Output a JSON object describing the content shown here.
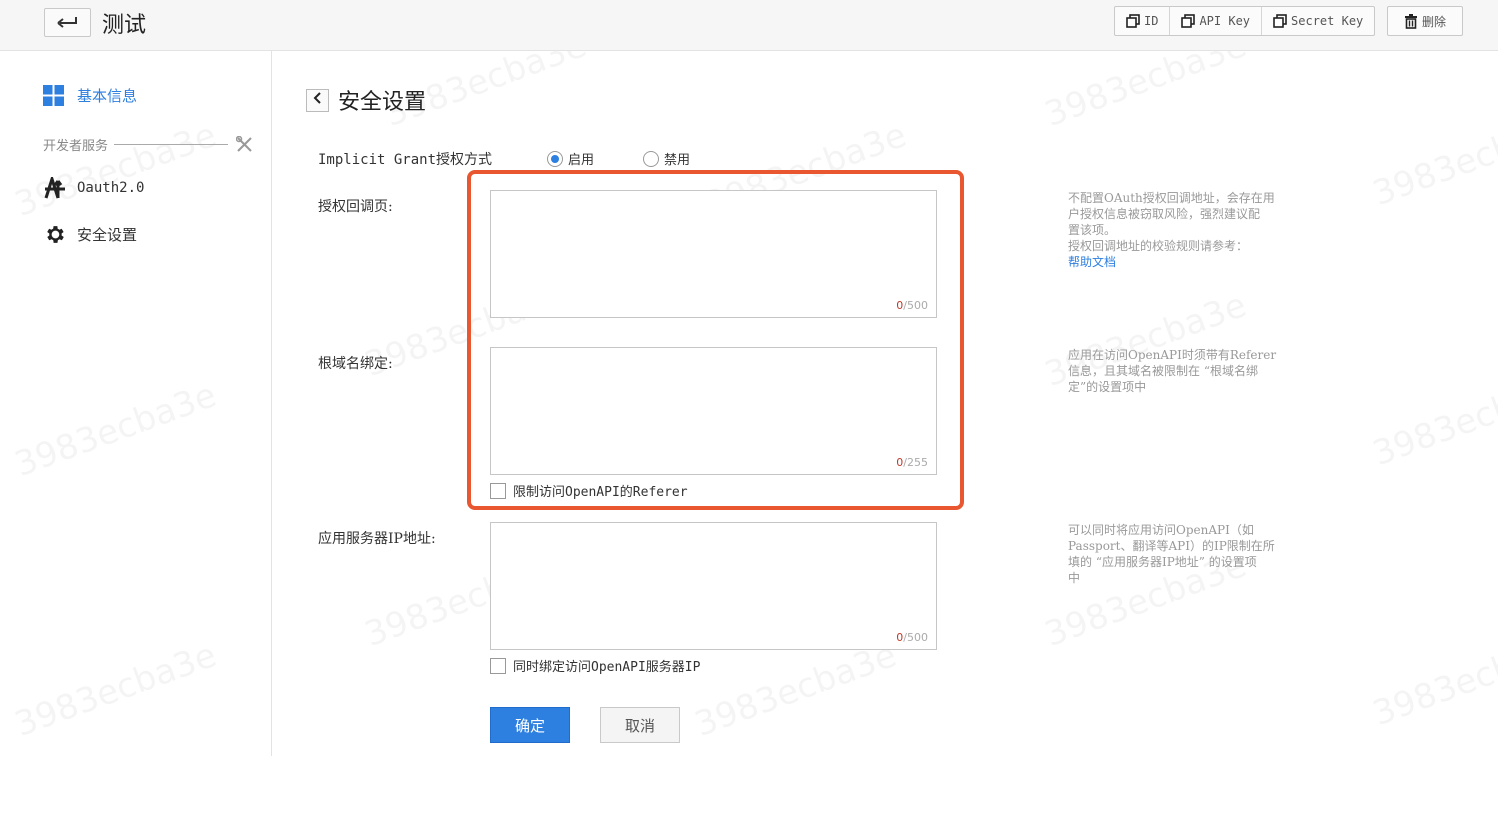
{
  "header": {
    "title": "测试",
    "buttons": {
      "id": "ID",
      "api_key": "API Key",
      "secret_key": "Secret Key",
      "delete": "删除"
    }
  },
  "sidebar": {
    "basic_info": "基本信息",
    "section_label": "开发者服务",
    "items": [
      {
        "label": "Oauth2.0",
        "icon": "oauth-icon"
      },
      {
        "label": "安全设置",
        "icon": "gear-icon"
      }
    ]
  },
  "main": {
    "title": "安全设置",
    "implicit_grant": {
      "label": "Implicit Grant授权方式",
      "options": [
        {
          "label": "启用",
          "selected": true
        },
        {
          "label": "禁用",
          "selected": false
        }
      ]
    },
    "auth_callback": {
      "label": "授权回调页:",
      "value": "",
      "count": "0",
      "max": "/500",
      "hint_lines": [
        "不配置OAuth授权回调地址，会存在用",
        "户授权信息被窃取风险，强烈建议配",
        "置该项。",
        "授权回调地址的校验规则请参考："
      ],
      "hint_link": "帮助文档"
    },
    "root_domain": {
      "label": "根域名绑定:",
      "value": "",
      "count": "0",
      "max": "/255",
      "checkbox": "限制访问OpenAPI的Referer",
      "hint_lines": [
        "应用在访问OpenAPI时须带有Referer",
        "信息，且其域名被限制在 “根域名绑",
        "定”的设置项中"
      ]
    },
    "server_ip": {
      "label": "应用服务器IP地址:",
      "value": "",
      "count": "0",
      "max": "/500",
      "checkbox": "同时绑定访问OpenAPI服务器IP",
      "hint_lines": [
        "可以同时将应用访问OpenAPI（如",
        "Passport、翻译等API）的IP限制在所",
        "填的 “应用服务器IP地址” 的设置项",
        "中"
      ]
    },
    "ok_label": "确定",
    "cancel_label": "取消"
  },
  "colors": {
    "accent": "#2d7fe0",
    "highlight_border": "#e8572f"
  }
}
